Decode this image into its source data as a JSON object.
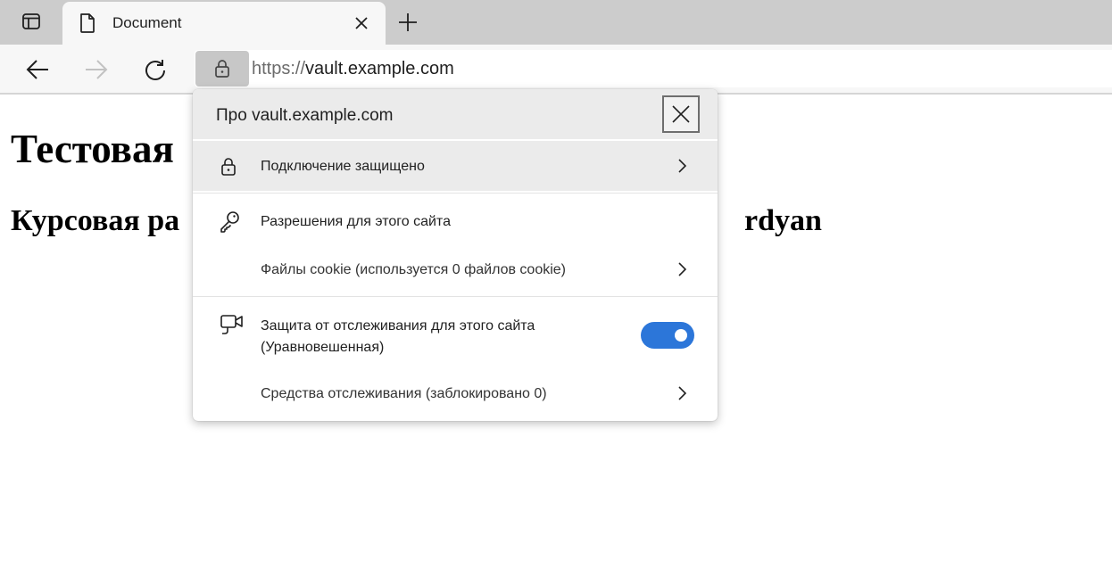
{
  "browser": {
    "tab": {
      "title": "Document"
    },
    "address_bar": {
      "scheme": "https://",
      "host": "vault.example.com"
    }
  },
  "page": {
    "heading1": "Тестовая",
    "heading2_left": "Курсовая ра",
    "heading2_right": "rdyan"
  },
  "site_info": {
    "title": "Про vault.example.com",
    "connection_label": "Подключение защищено",
    "permissions_label": "Разрешения для этого сайта",
    "cookies_label": "Файлы cookie (используется 0 файлов cookie)",
    "tracking_label_line1": "Защита от отслеживания для этого сайта",
    "tracking_label_line2": "(Уравновешенная)",
    "tracking_enabled": true,
    "trackers_label": "Средства отслеживания (заблокировано 0)"
  },
  "colors": {
    "toggle_on": "#2c76d9",
    "tabstrip": "#cccccc",
    "toolbar": "#f7f7f7"
  },
  "icons": [
    "tab-actions-icon",
    "page-icon",
    "close-icon",
    "plus-icon",
    "back-arrow-icon",
    "forward-arrow-icon",
    "refresh-icon",
    "lock-icon",
    "key-icon",
    "camera-icon",
    "chevron-right-icon"
  ]
}
